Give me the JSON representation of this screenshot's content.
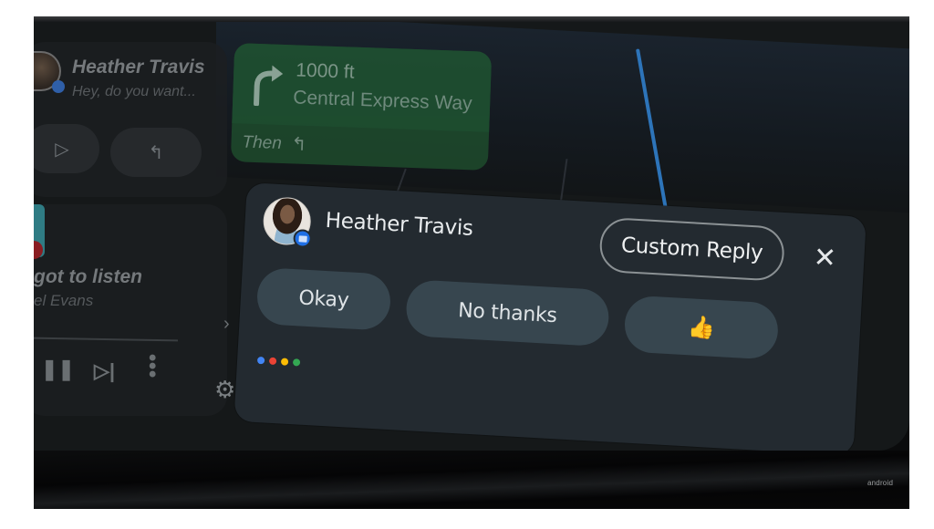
{
  "message_card": {
    "sender": "Heather Travis",
    "preview": "Hey, do you want...",
    "play_icon": "play-icon",
    "reply_icon": "reply-icon"
  },
  "media_card": {
    "title": "got to listen",
    "artist": "el Evans",
    "controls": {
      "pause": "pause-icon",
      "next": "skip-next-icon",
      "more": "more-vert-icon"
    }
  },
  "navigation": {
    "distance": "1000 ft",
    "street": "Central Express Way",
    "then_label": "Then",
    "maneuver_icon": "turn-right-icon",
    "then_icon": "turn-left-icon"
  },
  "notification": {
    "sender": "Heather Travis",
    "app_badge_icon": "messages-icon",
    "custom_reply_label": "Custom Reply",
    "close_icon": "close-icon",
    "quick_replies": [
      {
        "label": "Okay"
      },
      {
        "label": "No thanks"
      },
      {
        "label": "👍"
      }
    ],
    "assistant_colors": [
      "#4285f4",
      "#ea4335",
      "#fbbc05",
      "#34a853"
    ]
  },
  "sidebar": {
    "chevron_icon": "chevron-right-icon",
    "settings_icon": "gear-icon"
  },
  "watermark": "android"
}
